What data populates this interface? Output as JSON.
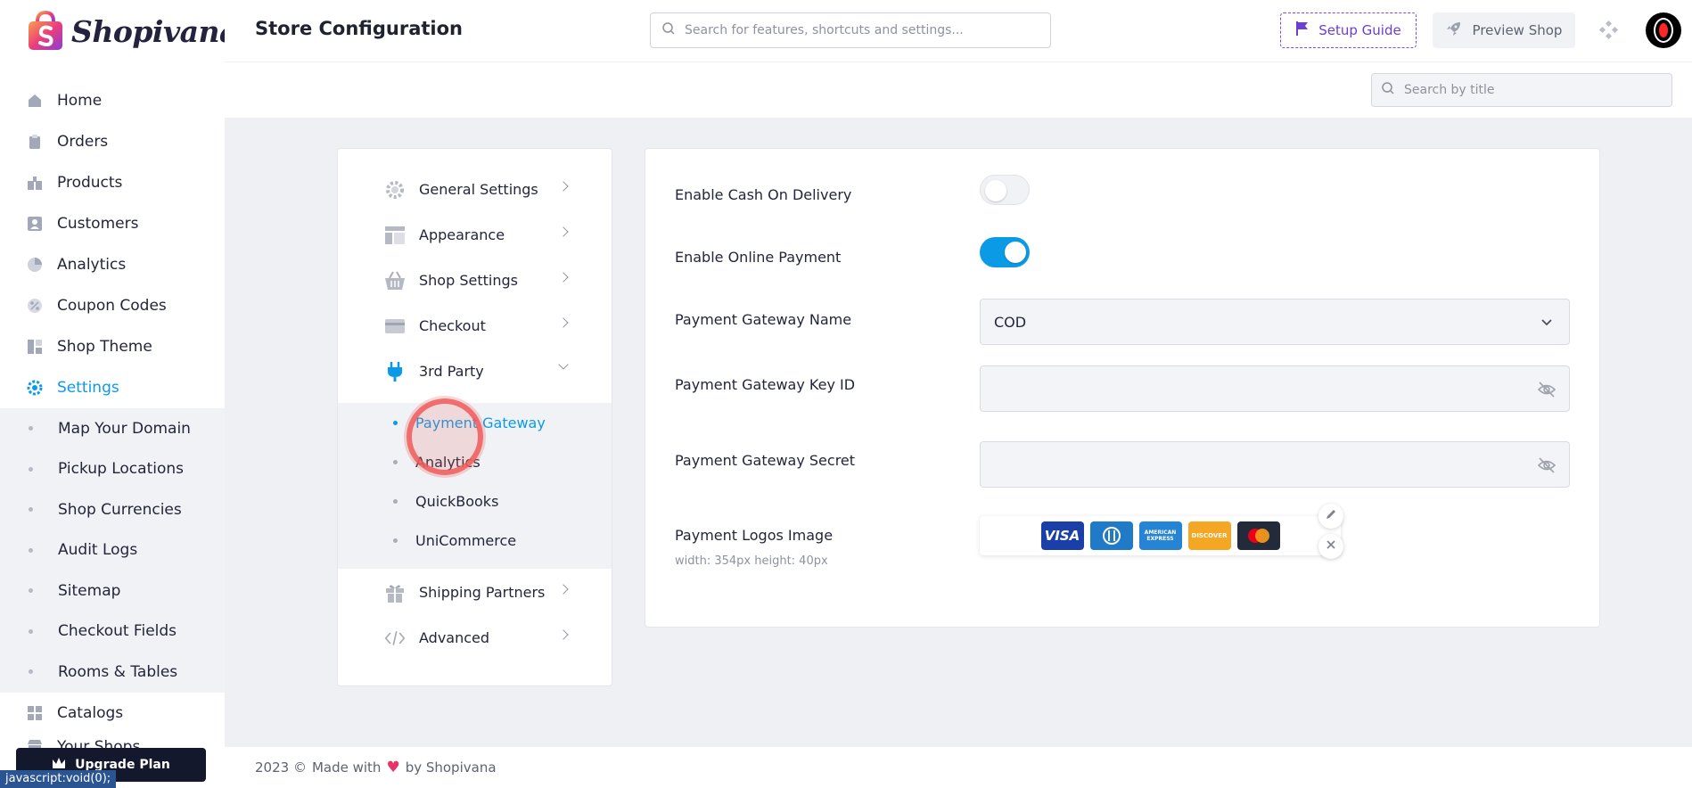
{
  "brand": {
    "name": "Shopivana"
  },
  "sidebar": {
    "items": [
      {
        "label": "Home",
        "icon": "home-icon"
      },
      {
        "label": "Orders",
        "icon": "clipboard-icon"
      },
      {
        "label": "Products",
        "icon": "box-icon"
      },
      {
        "label": "Customers",
        "icon": "user-card-icon"
      },
      {
        "label": "Analytics",
        "icon": "pie-chart-icon"
      },
      {
        "label": "Coupon Codes",
        "icon": "percent-icon"
      },
      {
        "label": "Shop Theme",
        "icon": "layout-icon"
      },
      {
        "label": "Settings",
        "icon": "gear-icon",
        "active": true
      }
    ],
    "sub_items": [
      "Map Your Domain",
      "Pickup Locations",
      "Shop Currencies",
      "Audit Logs",
      "Sitemap",
      "Checkout Fields",
      "Rooms & Tables"
    ],
    "after_items": [
      {
        "label": "Catalogs",
        "icon": "grid-icon"
      },
      {
        "label": "Your Shops",
        "icon": "store-icon"
      }
    ],
    "upgrade_label": "Upgrade Plan"
  },
  "status_bar": "javascript:void(0);",
  "header": {
    "title": "Store Configuration",
    "search_placeholder": "Search for features, shortcuts and settings...",
    "setup_guide_label": "Setup Guide",
    "preview_shop_label": "Preview Shop",
    "title_search_placeholder": "Search by title"
  },
  "settings_menu": {
    "items": [
      {
        "label": "General Settings",
        "icon": "gear-icon"
      },
      {
        "label": "Appearance",
        "icon": "layout-icon"
      },
      {
        "label": "Shop Settings",
        "icon": "basket-icon"
      },
      {
        "label": "Checkout",
        "icon": "credit-card-icon"
      },
      {
        "label": "3rd Party",
        "icon": "plug-icon",
        "expanded": true
      },
      {
        "label": "Shipping Partners",
        "icon": "gift-icon"
      },
      {
        "label": "Advanced",
        "icon": "code-icon"
      }
    ],
    "third_party_sub": [
      "Payment Gateway",
      "Analytics",
      "QuickBooks",
      "UniCommerce"
    ],
    "active_sub": "Payment Gateway"
  },
  "form": {
    "cod_label": "Enable Cash On Delivery",
    "cod_enabled": false,
    "online_label": "Enable Online Payment",
    "online_enabled": true,
    "gateway_name_label": "Payment Gateway Name",
    "gateway_name_value": "COD",
    "key_id_label": "Payment Gateway Key ID",
    "key_id_value": "",
    "secret_label": "Payment Gateway Secret",
    "secret_value": "",
    "logos_label": "Payment Logos Image",
    "logos_hint": "width: 354px height: 40px",
    "logos": [
      {
        "name": "VISA",
        "color": "#1a3fa8"
      },
      {
        "name": "DINERS",
        "color": "#1f7ac8"
      },
      {
        "name": "AMERICAN EXPRESS",
        "color": "#2584d3"
      },
      {
        "name": "DISCOVER",
        "color": "#f5a623"
      },
      {
        "name": "MASTERCARD",
        "color": "#232a3a"
      }
    ]
  },
  "footer": {
    "year": "2023 ©",
    "made_with": "Made with",
    "by": "by Shopivana"
  },
  "colors": {
    "accent": "#0b9be6",
    "purple": "#6b3ed6",
    "dark": "#14182c"
  }
}
